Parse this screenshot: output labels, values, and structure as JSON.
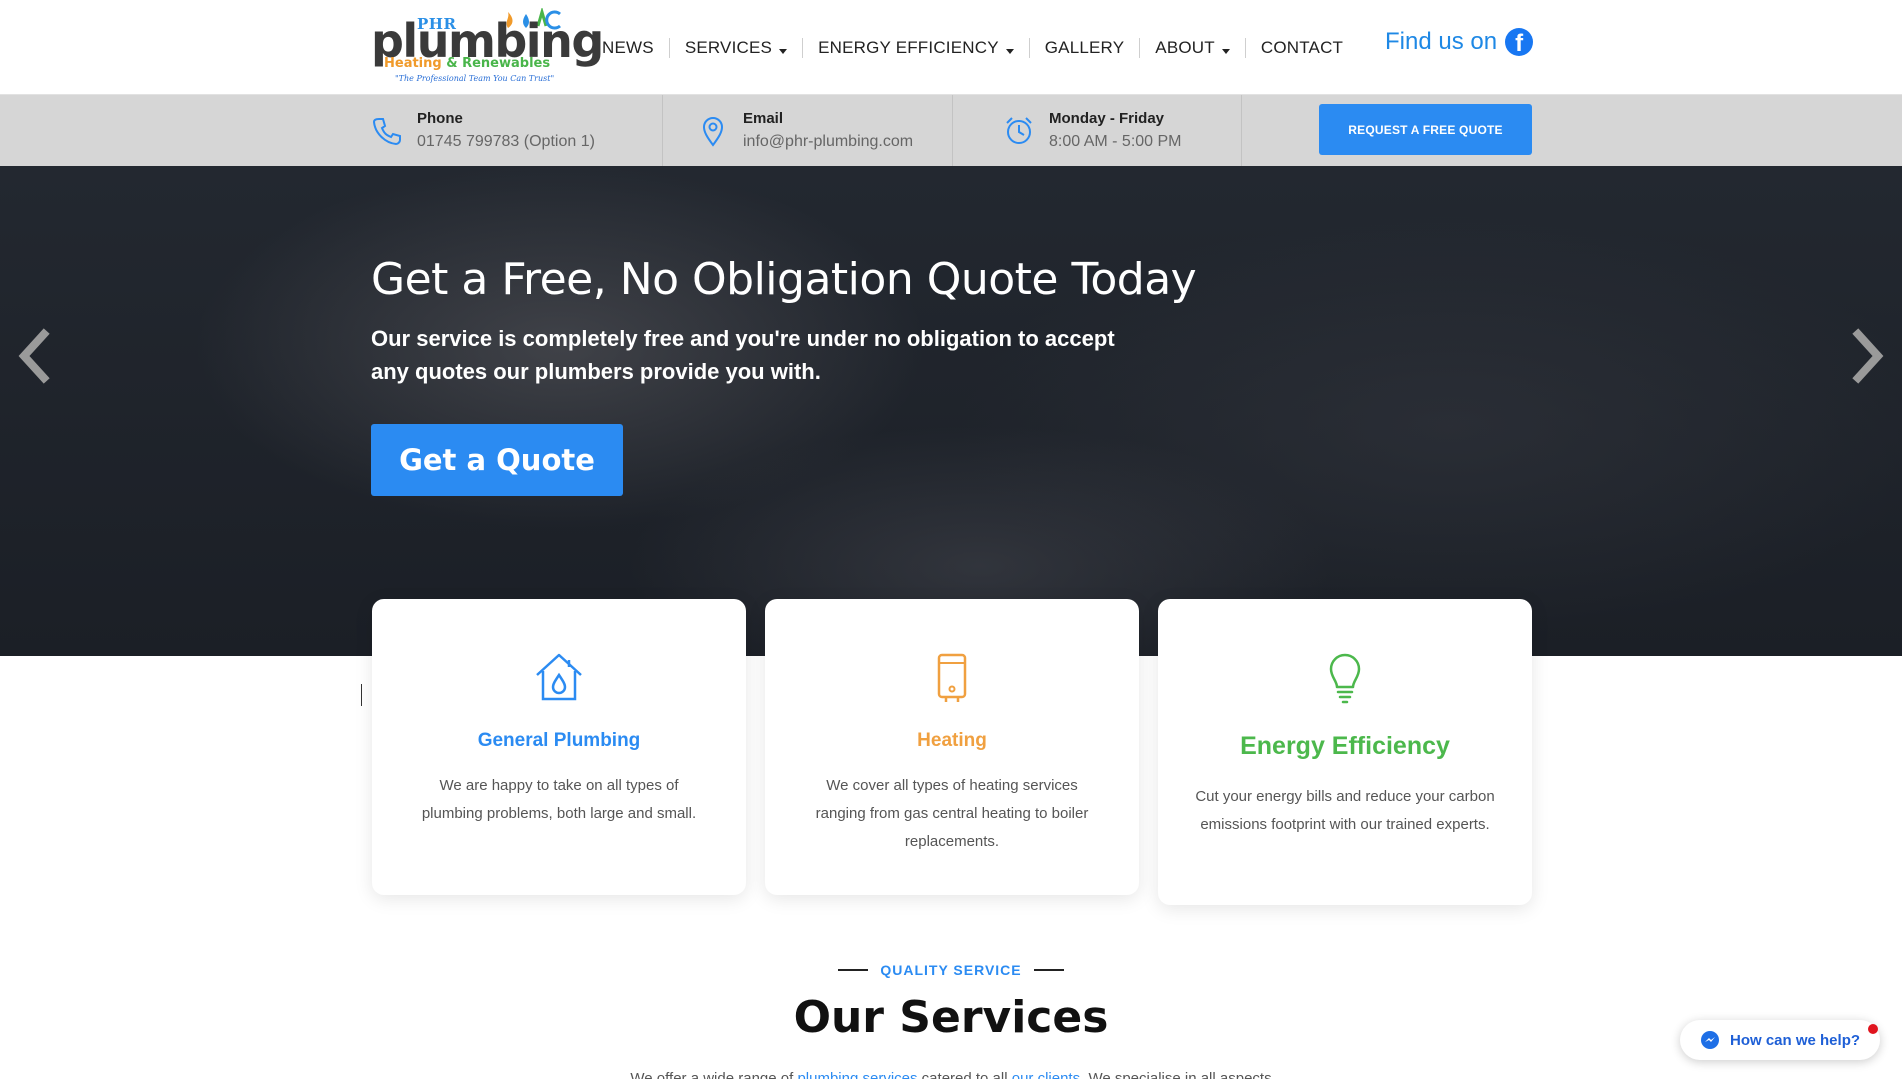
{
  "header": {
    "logo": {
      "phr": "PHR",
      "main": "plumbing",
      "sub_heating": "Heating ",
      "sub_amp": "&",
      "sub_renewables": " Renewables",
      "tagline": "\"The Professional Team You Can Trust\""
    },
    "nav": [
      {
        "label": "NEWS",
        "dropdown": false
      },
      {
        "label": "SERVICES",
        "dropdown": true
      },
      {
        "label": "ENERGY EFFICIENCY",
        "dropdown": true
      },
      {
        "label": "GALLERY",
        "dropdown": false
      },
      {
        "label": "ABOUT",
        "dropdown": true
      },
      {
        "label": "CONTACT",
        "dropdown": false
      }
    ],
    "find_us": "Find us on",
    "facebook_icon": "facebook-icon"
  },
  "infobar": {
    "phone": {
      "title": "Phone",
      "value": "01745 799783 (Option 1)",
      "icon": "phone-icon"
    },
    "email": {
      "title": "Email",
      "value": "info@phr-plumbing.com",
      "icon": "map-pin-icon"
    },
    "hours": {
      "title": "Monday - Friday",
      "value": "8:00 AM - 5:00 PM",
      "icon": "alarm-clock-icon"
    },
    "quote_button": "REQUEST A FREE QUOTE"
  },
  "hero": {
    "title": "Get a Free, No Obligation Quote Today",
    "subtitle": "Our service is completely free and you're under no obligation to accept any quotes our plumbers provide you with.",
    "button": "Get a Quote"
  },
  "cards": [
    {
      "title": "General Plumbing",
      "color": "#2b8bf2",
      "icon": "house-drop-icon",
      "text": "We are happy to take on all types of plumbing problems, both large and small."
    },
    {
      "title": "Heating",
      "color": "#f0a040",
      "icon": "boiler-icon",
      "text": "We cover all types of heating services ranging from gas central heating to boiler replacements."
    },
    {
      "title": "Energy Efficiency",
      "color": "#4cb84c",
      "icon": "lightbulb-icon",
      "text": "Cut your energy bills and reduce your carbon emissions footprint with our trained experts."
    }
  ],
  "services": {
    "eyebrow": "QUALITY SERVICE",
    "title": "Our Services",
    "intro_before": "We offer a wide range of ",
    "intro_link1": "plumbing services",
    "intro_mid": " catered to all ",
    "intro_link2": "our clients",
    "intro_after": ". We specialise in all aspects"
  },
  "chat": {
    "label": "How can we help?",
    "icon": "messenger-icon"
  },
  "colors": {
    "accent": "#2b8bf2",
    "heating": "#f0a040",
    "energy": "#4cb84c"
  }
}
